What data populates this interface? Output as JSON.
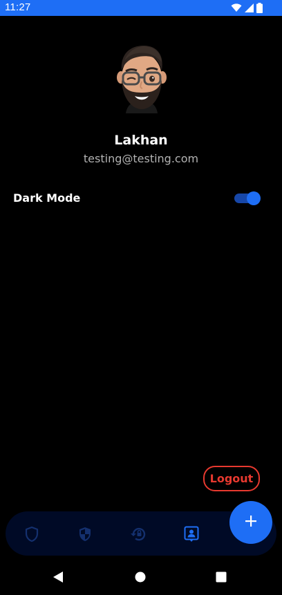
{
  "status_bar": {
    "time": "11:27",
    "background": "#1e6ef5",
    "icons": [
      "wifi-icon",
      "signal-icon",
      "battery-icon"
    ]
  },
  "profile": {
    "avatar_icon": "memoji-avatar-icon",
    "name": "Lakhan",
    "email": "testing@testing.com"
  },
  "settings": {
    "dark_mode_label": "Dark Mode",
    "dark_mode_enabled": true
  },
  "actions": {
    "logout_label": "Logout",
    "logout_color": "#e8392f",
    "fab_icon": "plus-icon"
  },
  "bottom_nav": {
    "items": [
      {
        "icon": "shield-icon",
        "active": false
      },
      {
        "icon": "security-shield-icon",
        "active": false
      },
      {
        "icon": "history-restore-icon",
        "active": false
      },
      {
        "icon": "profile-badge-icon",
        "active": true
      }
    ],
    "active_color": "#1e6ef5",
    "inactive_color": "#14306e"
  },
  "system_nav": {
    "icons": [
      "back-icon",
      "home-icon",
      "recents-icon"
    ]
  }
}
